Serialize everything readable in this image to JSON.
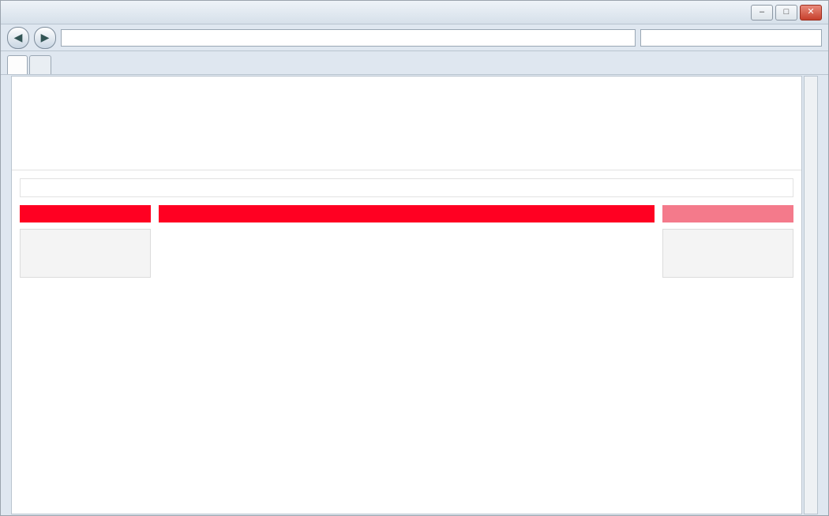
{
  "window": {
    "title": "",
    "minimize_label": "–",
    "maximize_label": "□",
    "close_label": "✕"
  },
  "addressbar": {
    "back_label": "◀",
    "forward_label": "▶",
    "url": "",
    "search_placeholder": ""
  },
  "tabs": [
    {
      "label": ""
    }
  ],
  "commandbar": {
    "items": []
  },
  "site": {
    "logo_text": "",
    "tagline": "",
    "nav": []
  },
  "sidebar_left": {
    "bar_label": "",
    "box_text": ""
  },
  "main": {
    "bar_label": "",
    "summary": "",
    "results": []
  },
  "sidebar_right": {
    "bar_label": "",
    "box_text": ""
  },
  "icons": {
    "back": "back-arrow-icon",
    "forward": "forward-arrow-icon"
  }
}
